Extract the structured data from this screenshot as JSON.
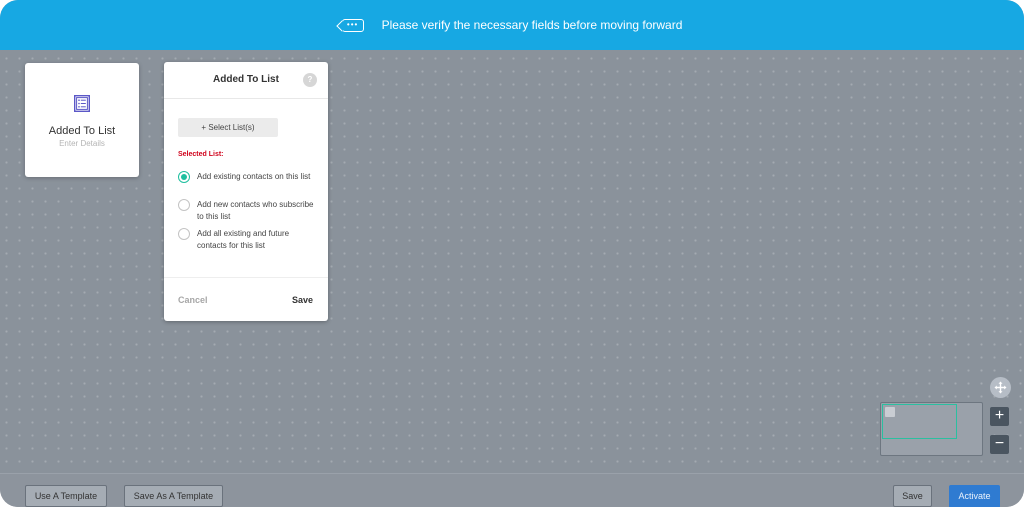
{
  "banner": {
    "icon": "chat-bubble-icon",
    "icon_glyph": "•••",
    "message": "Please verify the necessary fields before moving forward"
  },
  "node": {
    "icon": "list-icon",
    "title": "Added To List",
    "subtitle": "Enter Details"
  },
  "panel": {
    "title": "Added To List",
    "help_icon": "help-icon",
    "help_glyph": "?",
    "select_button": "+ Select List(s)",
    "selected_label": "Selected List:",
    "options": [
      {
        "label": "Add existing contacts on this list",
        "selected": true
      },
      {
        "label": "Add new contacts who subscribe to this list",
        "selected": false
      },
      {
        "label": "Add all existing and future contacts for this list",
        "selected": false
      }
    ],
    "cancel": "Cancel",
    "save": "Save"
  },
  "zoom": {
    "move_icon": "move-icon",
    "zoom_in": "+",
    "zoom_out": "−"
  },
  "footer": {
    "use_template": "Use A Template",
    "save_as_template": "Save As A Template",
    "save": "Save",
    "activate": "Activate"
  },
  "colors": {
    "banner": "#17a8e3",
    "accent_green": "#1fbf9f",
    "required_red": "#d0021b",
    "activate_blue": "#2f7bd1",
    "canvas": "#8a929b"
  }
}
